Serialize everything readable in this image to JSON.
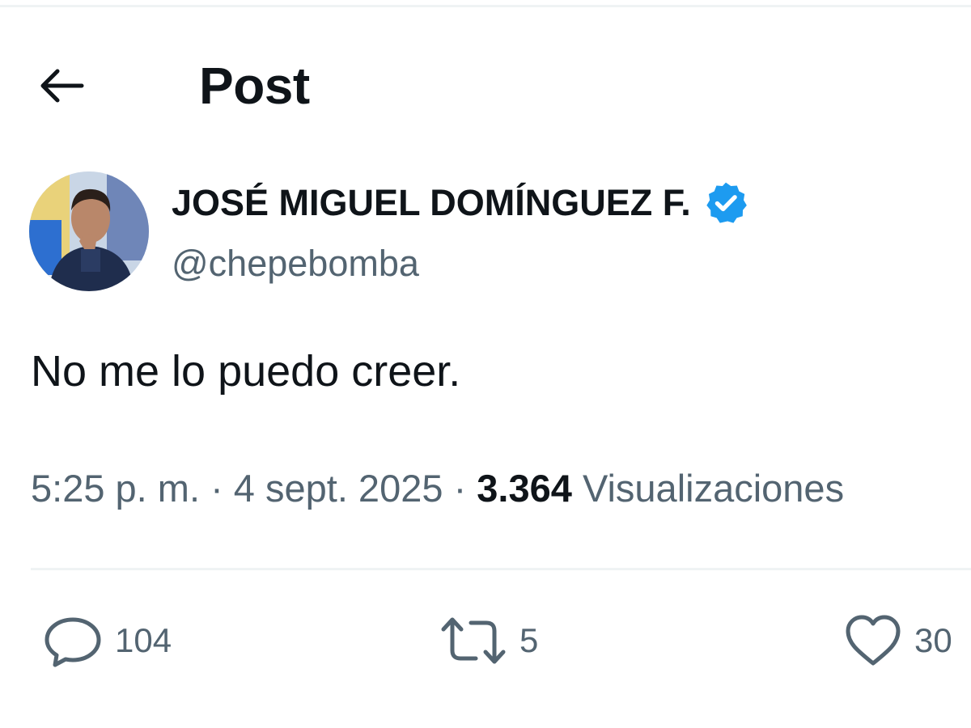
{
  "header": {
    "title": "Post",
    "back_icon": "arrow-left-icon"
  },
  "author": {
    "name": "JOSÉ MIGUEL DOMÍNGUEZ F.",
    "handle": "@chepebomba",
    "verified": true,
    "verified_color": "#1d9bf0"
  },
  "post": {
    "text": "No me lo puedo creer.",
    "time": "5:25 p. m.",
    "separator": "·",
    "date": "4 sept. 2025",
    "views_count": "3.364",
    "views_label": "Visualizaciones"
  },
  "actions": {
    "replies": "104",
    "reposts": "5",
    "likes": "30"
  },
  "colors": {
    "text_primary": "#0f1419",
    "text_secondary": "#536471",
    "divider": "#eff3f4",
    "accent": "#1d9bf0"
  }
}
